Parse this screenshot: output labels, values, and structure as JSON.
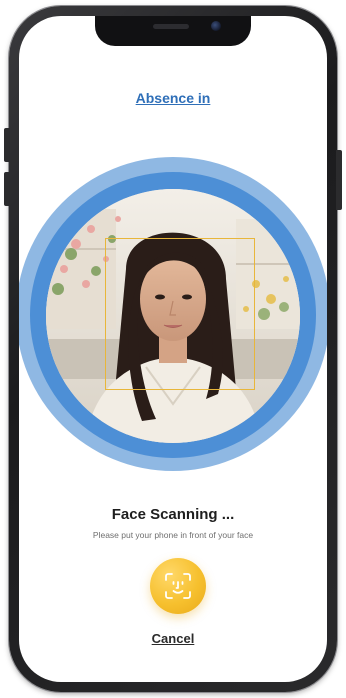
{
  "header": {
    "title": "Absence in"
  },
  "scanner": {
    "title": "Face Scanning ...",
    "instruction": "Please put your phone in front of your face",
    "button_icon": "face-id-icon",
    "ring_outer_color": "#8fb8e3",
    "ring_inner_color": "#4d8fd6",
    "frame_color": "#e8b63a",
    "button_color": "#f6c02e"
  },
  "footer": {
    "cancel_label": "Cancel"
  }
}
